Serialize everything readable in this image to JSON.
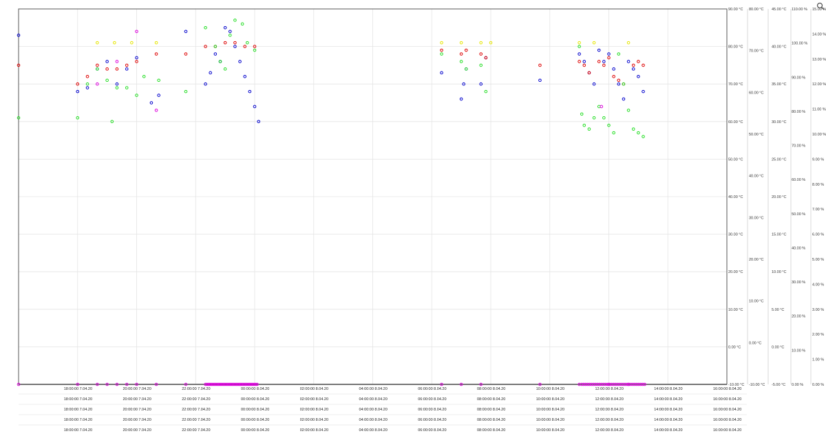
{
  "chart_data": {
    "type": "scatter",
    "x_axis": {
      "start": "2020-04-07T18:00:00",
      "end": "2020-04-08T16:00:00",
      "tick_labels": [
        "18:00:00 7.04.20",
        "20:00:00 7.04.20",
        "22:00:00 7.04.20",
        "00:00:00 8.04.20",
        "02:00:00 8.04.20",
        "04:00:00 8.04.20",
        "06:00:00 8.04.20",
        "08:00:00 8.04.20",
        "10:00:00 8.04.20",
        "12:00:00 8.04.20",
        "14:00:00 8.04.20",
        "16:00:00 8.04.20"
      ],
      "rows": 5
    },
    "y_axes": [
      {
        "id": "ax1",
        "min": -10,
        "max": 90,
        "step": 10,
        "unit": "°C",
        "labels": [
          "-10.00 °C",
          "0.00 °C",
          "10.00 °C",
          "20.00 °C",
          "30.00 °C",
          "40.00 °C",
          "50.00 °C",
          "60.00 °C",
          "70.00 °C",
          "80.00 °C",
          "90.00 °C"
        ]
      },
      {
        "id": "ax2",
        "min": -10,
        "max": 80,
        "step": 10,
        "unit": "°C",
        "labels": [
          "-10.00 °C",
          "0.00 °C",
          "10.00 °C",
          "20.00 °C",
          "30.00 °C",
          "40.00 °C",
          "50.00 °C",
          "60.00 °C",
          "70.00 °C",
          "80.00 °C"
        ]
      },
      {
        "id": "ax3",
        "min": -5,
        "max": 45,
        "step": 5,
        "unit": "°C",
        "labels": [
          "-5.00 °C",
          "0.00 °C",
          "5.00 °C",
          "10.00 °C",
          "15.00 °C",
          "20.00 °C",
          "25.00 °C",
          "30.00 °C",
          "35.00 °C",
          "40.00 °C",
          "45.00 °C"
        ]
      },
      {
        "id": "ax4",
        "min": 0,
        "max": 110,
        "step": 10,
        "unit": "%",
        "labels": [
          "0.00 %",
          "10.00 %",
          "20.00 %",
          "30.00 %",
          "40.00 %",
          "50.00 %",
          "60.00 %",
          "70.00 %",
          "80.00 %",
          "90.00 %",
          "100.00 %",
          "110.00 %"
        ]
      },
      {
        "id": "ax5",
        "min": 0,
        "max": 15,
        "step": 1,
        "unit": "%",
        "labels": [
          "0.00 %",
          "1.00 %",
          "2.00 %",
          "3.00 %",
          "4.00 %",
          "5.00 %",
          "6.00 %",
          "7.00 %",
          "8.00 %",
          "9.00 %",
          "10.00 %",
          "11.00 %",
          "12.00 %",
          "13.00 %",
          "14.00 %",
          "15.00 %"
        ]
      }
    ],
    "grid": true,
    "legend": "none",
    "series": [
      {
        "color": "#0000cc",
        "axis": "ax1",
        "points": [
          [
            "2020-04-07T16:00",
            83
          ],
          [
            "2020-04-07T18:00",
            68
          ],
          [
            "2020-04-07T18:20",
            69
          ],
          [
            "2020-04-07T18:40",
            74
          ],
          [
            "2020-04-07T19:00",
            76
          ],
          [
            "2020-04-07T19:20",
            70
          ],
          [
            "2020-04-07T19:40",
            74
          ],
          [
            "2020-04-07T20:00",
            77
          ],
          [
            "2020-04-07T20:30",
            65
          ],
          [
            "2020-04-07T20:45",
            67
          ],
          [
            "2020-04-07T21:40",
            84
          ],
          [
            "2020-04-07T22:20",
            70
          ],
          [
            "2020-04-07T22:30",
            73
          ],
          [
            "2020-04-07T22:40",
            78
          ],
          [
            "2020-04-07T22:50",
            76
          ],
          [
            "2020-04-07T23:00",
            85
          ],
          [
            "2020-04-07T23:10",
            84
          ],
          [
            "2020-04-07T23:20",
            80
          ],
          [
            "2020-04-07T23:30",
            76
          ],
          [
            "2020-04-07T23:40",
            72
          ],
          [
            "2020-04-07T23:50",
            68
          ],
          [
            "2020-04-08T00:00",
            64
          ],
          [
            "2020-04-08T00:08",
            60
          ],
          [
            "2020-04-08T06:20",
            73
          ],
          [
            "2020-04-08T07:00",
            66
          ],
          [
            "2020-04-08T07:05",
            70
          ],
          [
            "2020-04-08T07:10",
            74
          ],
          [
            "2020-04-08T07:40",
            70
          ],
          [
            "2020-04-08T07:50",
            77
          ],
          [
            "2020-04-08T09:40",
            71
          ],
          [
            "2020-04-08T11:00",
            78
          ],
          [
            "2020-04-08T11:10",
            76
          ],
          [
            "2020-04-08T11:20",
            73
          ],
          [
            "2020-04-08T11:30",
            70
          ],
          [
            "2020-04-08T11:40",
            79
          ],
          [
            "2020-04-08T11:50",
            76
          ],
          [
            "2020-04-08T12:00",
            78
          ],
          [
            "2020-04-08T12:10",
            74
          ],
          [
            "2020-04-08T12:20",
            70
          ],
          [
            "2020-04-08T12:30",
            66
          ],
          [
            "2020-04-08T12:40",
            76
          ],
          [
            "2020-04-08T12:50",
            74
          ],
          [
            "2020-04-08T13:00",
            72
          ],
          [
            "2020-04-08T13:10",
            68
          ]
        ]
      },
      {
        "color": "#dd0000",
        "axis": "ax1",
        "points": [
          [
            "2020-04-07T16:00",
            75
          ],
          [
            "2020-04-07T18:00",
            70
          ],
          [
            "2020-04-07T18:20",
            72
          ],
          [
            "2020-04-07T18:40",
            75
          ],
          [
            "2020-04-07T19:00",
            74
          ],
          [
            "2020-04-07T19:20",
            74
          ],
          [
            "2020-04-07T19:40",
            75
          ],
          [
            "2020-04-07T20:00",
            76
          ],
          [
            "2020-04-07T20:40",
            78
          ],
          [
            "2020-04-07T21:40",
            78
          ],
          [
            "2020-04-07T22:20",
            80
          ],
          [
            "2020-04-07T22:40",
            80
          ],
          [
            "2020-04-07T23:00",
            81
          ],
          [
            "2020-04-07T23:20",
            81
          ],
          [
            "2020-04-07T23:40",
            80
          ],
          [
            "2020-04-08T00:00",
            80
          ],
          [
            "2020-04-08T06:20",
            79
          ],
          [
            "2020-04-08T07:00",
            78
          ],
          [
            "2020-04-08T07:10",
            79
          ],
          [
            "2020-04-08T07:40",
            78
          ],
          [
            "2020-04-08T07:50",
            77
          ],
          [
            "2020-04-08T09:40",
            75
          ],
          [
            "2020-04-08T11:00",
            76
          ],
          [
            "2020-04-08T11:10",
            75
          ],
          [
            "2020-04-08T11:20",
            73
          ],
          [
            "2020-04-08T11:40",
            76
          ],
          [
            "2020-04-08T11:50",
            75
          ],
          [
            "2020-04-08T12:00",
            77
          ],
          [
            "2020-04-08T12:10",
            72
          ],
          [
            "2020-04-08T12:20",
            71
          ],
          [
            "2020-04-08T12:30",
            70
          ],
          [
            "2020-04-08T12:50",
            75
          ],
          [
            "2020-04-08T13:00",
            76
          ],
          [
            "2020-04-08T13:10",
            75
          ]
        ]
      },
      {
        "color": "#22dd22",
        "axis": "ax1",
        "points": [
          [
            "2020-04-07T16:00",
            61
          ],
          [
            "2020-04-07T18:00",
            61
          ],
          [
            "2020-04-07T18:20",
            70
          ],
          [
            "2020-04-07T18:40",
            74
          ],
          [
            "2020-04-07T19:00",
            71
          ],
          [
            "2020-04-07T19:10",
            60
          ],
          [
            "2020-04-07T19:20",
            69
          ],
          [
            "2020-04-07T19:40",
            69
          ],
          [
            "2020-04-07T20:00",
            67
          ],
          [
            "2020-04-07T20:15",
            72
          ],
          [
            "2020-04-07T20:45",
            71
          ],
          [
            "2020-04-07T21:40",
            68
          ],
          [
            "2020-04-07T22:20",
            85
          ],
          [
            "2020-04-07T22:40",
            80
          ],
          [
            "2020-04-07T22:50",
            76
          ],
          [
            "2020-04-07T23:00",
            74
          ],
          [
            "2020-04-07T23:10",
            83
          ],
          [
            "2020-04-07T23:20",
            87
          ],
          [
            "2020-04-07T23:35",
            86
          ],
          [
            "2020-04-07T23:45",
            81
          ],
          [
            "2020-04-08T00:00",
            79
          ],
          [
            "2020-04-08T06:20",
            78
          ],
          [
            "2020-04-08T07:00",
            76
          ],
          [
            "2020-04-08T07:10",
            74
          ],
          [
            "2020-04-08T07:40",
            75
          ],
          [
            "2020-04-08T07:50",
            68
          ],
          [
            "2020-04-08T11:00",
            80
          ],
          [
            "2020-04-08T11:05",
            62
          ],
          [
            "2020-04-08T11:10",
            59
          ],
          [
            "2020-04-08T11:20",
            58
          ],
          [
            "2020-04-08T11:30",
            61
          ],
          [
            "2020-04-08T11:40",
            64
          ],
          [
            "2020-04-08T11:50",
            61
          ],
          [
            "2020-04-08T12:00",
            59
          ],
          [
            "2020-04-08T12:10",
            57
          ],
          [
            "2020-04-08T12:20",
            78
          ],
          [
            "2020-04-08T12:30",
            70
          ],
          [
            "2020-04-08T12:40",
            63
          ],
          [
            "2020-04-08T12:50",
            58
          ],
          [
            "2020-04-08T13:00",
            57
          ],
          [
            "2020-04-08T13:10",
            56
          ]
        ]
      },
      {
        "color": "#e6e600",
        "axis": "ax1",
        "points": [
          [
            "2020-04-07T18:40",
            81
          ],
          [
            "2020-04-07T19:15",
            81
          ],
          [
            "2020-04-07T19:50",
            81
          ],
          [
            "2020-04-07T20:40",
            81
          ],
          [
            "2020-04-08T06:20",
            81
          ],
          [
            "2020-04-08T07:00",
            81
          ],
          [
            "2020-04-08T07:40",
            81
          ],
          [
            "2020-04-08T08:00",
            81
          ],
          [
            "2020-04-08T11:00",
            81
          ],
          [
            "2020-04-08T11:30",
            81
          ],
          [
            "2020-04-08T12:40",
            81
          ]
        ]
      },
      {
        "color": "#dd00dd",
        "axis": "ax1",
        "points": [
          [
            "2020-04-07T18:40",
            70
          ],
          [
            "2020-04-07T19:20",
            76
          ],
          [
            "2020-04-07T20:00",
            84
          ],
          [
            "2020-04-07T20:40",
            63
          ],
          [
            "2020-04-08T11:45",
            64
          ]
        ]
      }
    ]
  },
  "toolbar": {
    "zoom_icon": "zoom-icon"
  }
}
